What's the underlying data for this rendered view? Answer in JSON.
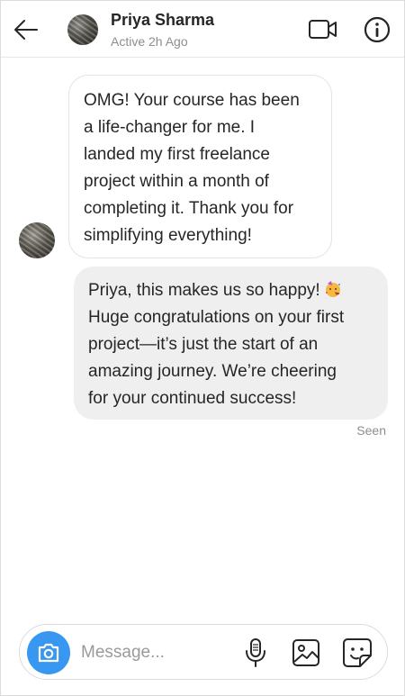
{
  "header": {
    "name": "Priya Sharma",
    "status": "Active 2h Ago",
    "icons": {
      "back": "back-arrow-icon",
      "video": "video-camera-icon",
      "info": "info-icon"
    }
  },
  "messages": [
    {
      "direction": "incoming",
      "lines": [
        "OMG! Your course has been",
        "a life-changer for me. I",
        "landed my first freelance",
        "project within a month of",
        "completing it. Thank you for",
        "simplifying everything!"
      ]
    },
    {
      "direction": "outgoing",
      "lines": [
        "Priya, this makes us so happy!",
        "Huge congratulations on your first",
        "project—it’s just the start of an",
        "amazing journey. We’re cheering",
        "for your continued success!"
      ],
      "emoji": "partying-face"
    }
  ],
  "seen": "Seen",
  "composer": {
    "placeholder": "Message...",
    "icons": {
      "camera": "camera-icon",
      "mic": "microphone-icon",
      "image": "image-icon",
      "sticker": "sticker-icon"
    },
    "accent": "#3897f0"
  }
}
